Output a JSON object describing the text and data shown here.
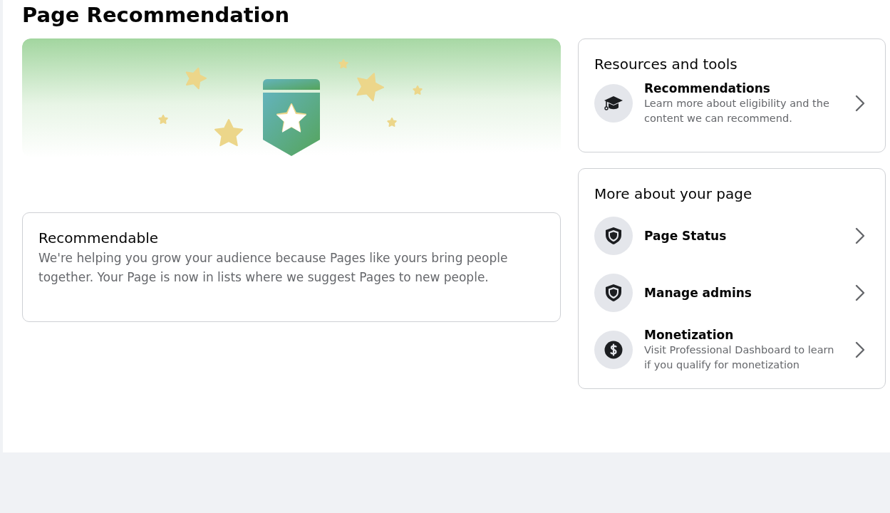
{
  "title": "Page Recommendation",
  "status_card": {
    "heading": "Recommendable",
    "text": "We're helping you grow your audience because Pages like yours bring people together. Your Page is now in lists where we suggest Pages to new people."
  },
  "resources": {
    "heading": "Resources and tools",
    "items": [
      {
        "kind": "cap",
        "label": "Recommendations",
        "description": "Learn more about eligibility and the content we can recommend."
      }
    ]
  },
  "more": {
    "heading": "More about your page",
    "items": [
      {
        "kind": "shield",
        "label": "Page Status"
      },
      {
        "kind": "shield",
        "label": "Manage admins"
      },
      {
        "kind": "dollar",
        "label": "Monetization",
        "description": "Visit Professional Dashboard to learn if you qualify for monetization"
      }
    ]
  }
}
